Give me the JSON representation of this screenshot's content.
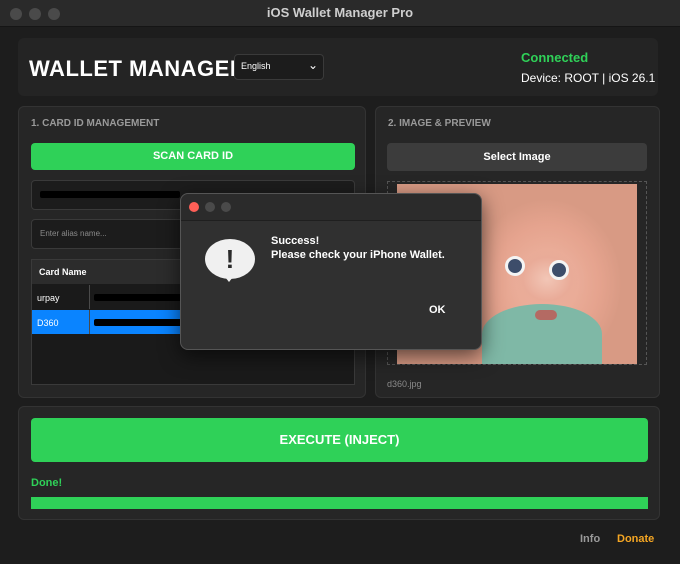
{
  "window": {
    "title": "iOS Wallet Manager Pro"
  },
  "header": {
    "app_title": "WALLET MANAGER",
    "language": "English",
    "status": "Connected",
    "device": "Device: ROOT | iOS 26.1"
  },
  "card_panel": {
    "title": "1. CARD ID MANAGEMENT",
    "scan_button": "SCAN CARD ID",
    "alias_placeholder": "Enter alias name...",
    "table": {
      "header": "Card Name",
      "rows": [
        {
          "name": "urpay",
          "selected": false
        },
        {
          "name": "D360",
          "selected": true
        }
      ]
    }
  },
  "image_panel": {
    "title": "2. IMAGE & PREVIEW",
    "select_button": "Select Image",
    "filename": "d360.jpg"
  },
  "execute": {
    "button": "EXECUTE (INJECT)",
    "status": "Done!",
    "progress": 1.0
  },
  "footer": {
    "info": "Info",
    "donate": "Donate"
  },
  "dialog": {
    "line1": "Success!",
    "line2": "Please check your iPhone Wallet.",
    "ok": "OK"
  },
  "colors": {
    "accent_green": "#2fd158",
    "selected_row": "#0a84ff",
    "donate": "#f5a623",
    "close_red": "#ff5f57"
  },
  "icons": [
    "chevron-down-icon",
    "alert-bubble-icon"
  ]
}
